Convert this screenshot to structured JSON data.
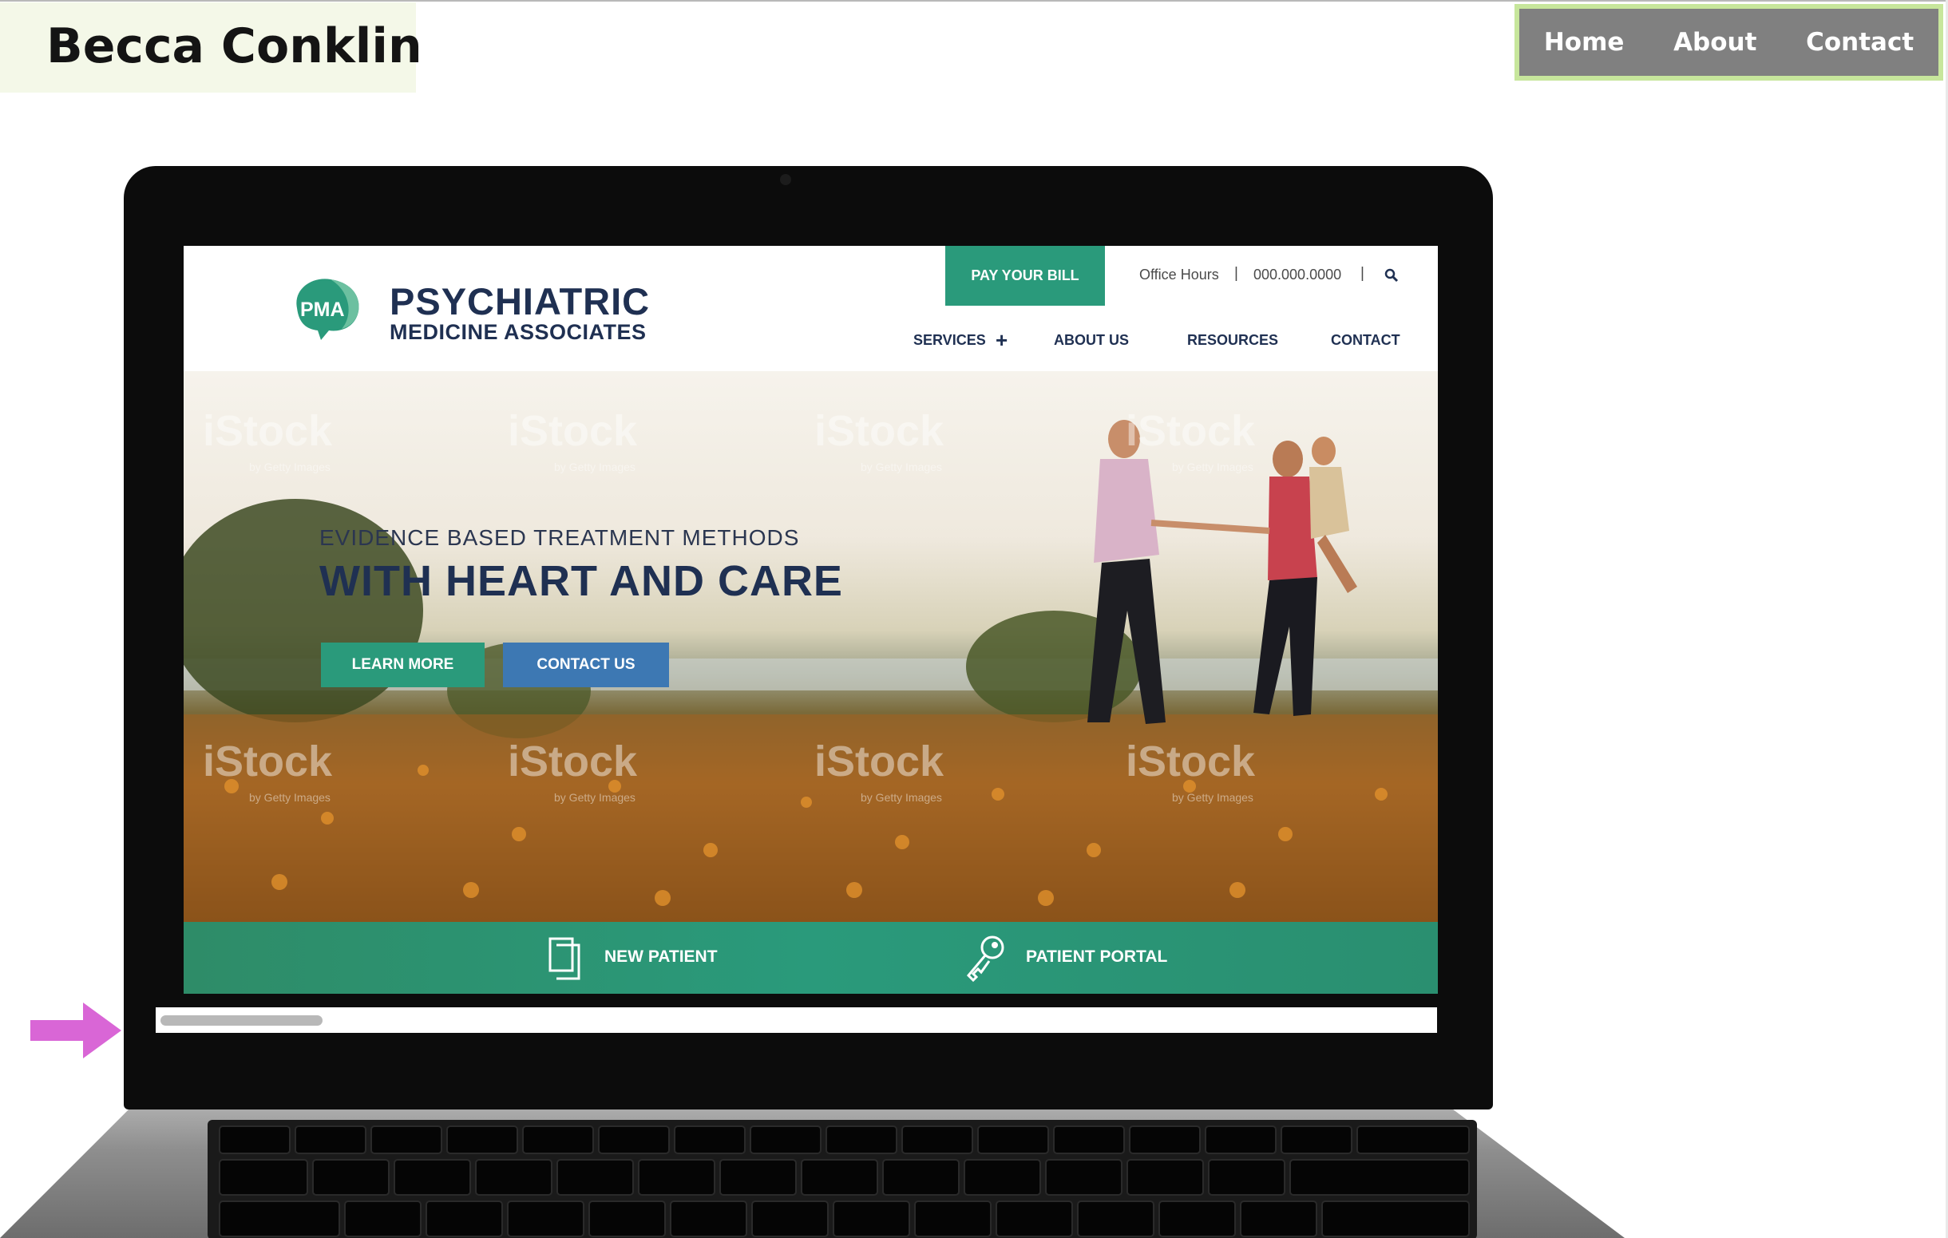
{
  "portfolio": {
    "name": "Becca Conklin",
    "nav": [
      "Home",
      "About",
      "Contact"
    ]
  },
  "colors": {
    "brand_bg": "#f4f8e8",
    "nav_bg": "#808080",
    "nav_border": "#c7e69c",
    "pma_green": "#2a9a7b",
    "pma_blue": "#3d78b3",
    "pma_navy": "#1f3052",
    "arrow": "#d966d6"
  },
  "pma": {
    "logo_letters": "PMA",
    "title_line1": "PSYCHIATRIC",
    "title_line2": "MEDICINE ASSOCIATES",
    "pay_bill": "PAY YOUR BILL",
    "office_hours": "Office Hours",
    "separator": "|",
    "phone": "000.000.0000",
    "menu": {
      "services": "SERVICES",
      "about_us": "ABOUT US",
      "resources": "RESOURCES",
      "contact": "CONTACT"
    },
    "hero": {
      "kicker": "EVIDENCE BASED TREATMENT METHODS",
      "title": "WITH HEART AND CARE",
      "learn_more": "LEARN MORE",
      "contact_us": "CONTACT US",
      "watermark": "iStock",
      "watermark_sub": "by Getty Images"
    },
    "bottom_bar": {
      "new_patient": "NEW PATIENT",
      "patient_portal": "PATIENT PORTAL"
    }
  }
}
